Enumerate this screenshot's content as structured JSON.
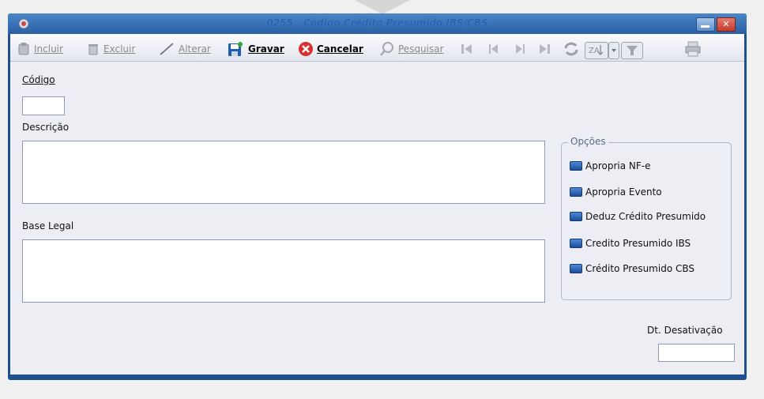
{
  "window": {
    "title": "0255 - Código Crédito Presumido IBS/CBS",
    "close_glyph": "✕"
  },
  "toolbar": {
    "incluir": "Incluir",
    "excluir": "Excluir",
    "alterar": "Alterar",
    "gravar": "Gravar",
    "cancelar": "Cancelar",
    "pesquisar": "Pesquisar",
    "icons": [
      "add-record-icon",
      "delete-record-icon",
      "edit-pencil-icon",
      "save-disk-icon",
      "cancel-icon",
      "search-icon",
      "first-record-icon",
      "previous-record-icon",
      "next-record-icon",
      "last-record-icon",
      "refresh-icon",
      "sort-icon",
      "filter-icon",
      "print-icon"
    ]
  },
  "form": {
    "codigo_label": "Código",
    "codigo_value": "",
    "descricao_label": "Descrição",
    "descricao_value": "",
    "base_legal_label": "Base Legal",
    "base_legal_value": "",
    "dt_desativacao_label": "Dt. Desativação",
    "dt_desativacao_value": ""
  },
  "options": {
    "title": "Opções",
    "items": [
      {
        "label": "Apropria NF-e",
        "checked": false
      },
      {
        "label": "Apropria Evento",
        "checked": false
      },
      {
        "label": "Deduz Crédito Presumido",
        "checked": false
      },
      {
        "label": "Credito Presumido IBS",
        "checked": false
      },
      {
        "label": "Crédito Presumido CBS",
        "checked": false
      }
    ]
  },
  "colors": {
    "title_bar": "#2a5fa3",
    "window_border": "#1f4f8f",
    "checkbox": "#2b5fb0",
    "content_bg": "#eceef4"
  }
}
